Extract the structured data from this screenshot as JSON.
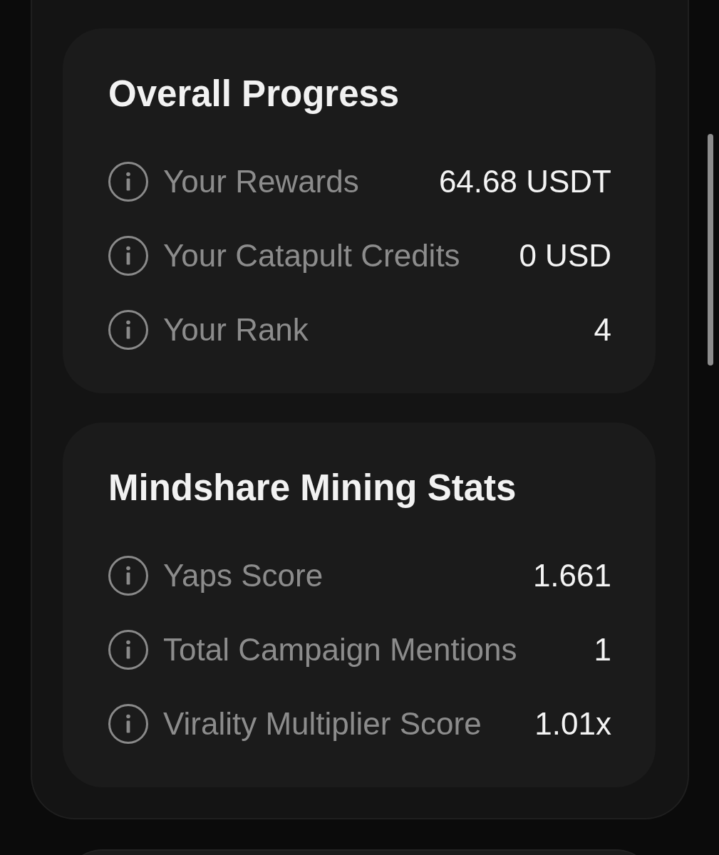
{
  "sections": [
    {
      "title": "Overall Progress",
      "rows": [
        {
          "label": "Your Rewards",
          "value": "64.68 USDT"
        },
        {
          "label": "Your Catapult Credits",
          "value": "0 USD"
        },
        {
          "label": "Your Rank",
          "value": "4"
        }
      ]
    },
    {
      "title": "Mindshare Mining Stats",
      "rows": [
        {
          "label": "Yaps Score",
          "value": "1.661"
        },
        {
          "label": "Total Campaign Mentions",
          "value": "1"
        },
        {
          "label": "Virality Multiplier Score",
          "value": "1.01x"
        }
      ]
    }
  ]
}
